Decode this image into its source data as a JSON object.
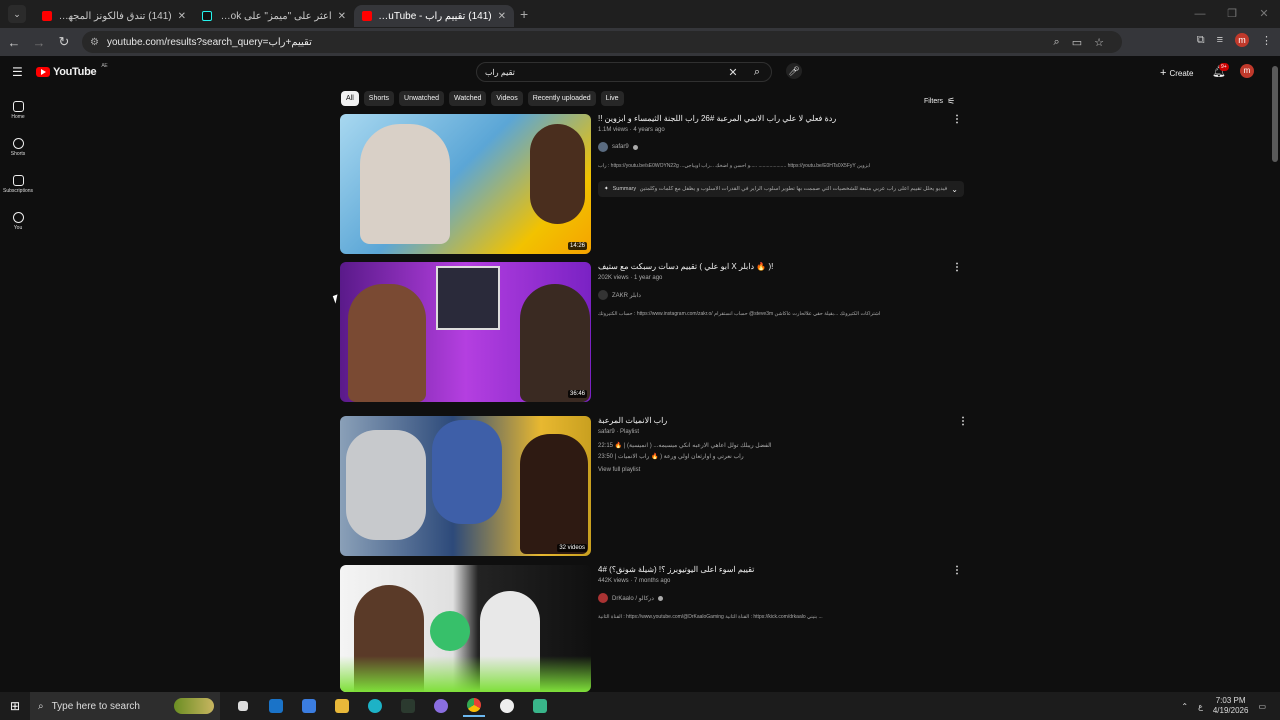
{
  "browser": {
    "tabs": [
      {
        "title": "(141) تندق فالكونز المجهول",
        "favicon": "youtube-icon",
        "active": false
      },
      {
        "title": "اعثر على \"ميمز\" على TikTok | بحث",
        "favicon": "tiktok-icon",
        "active": false
      },
      {
        "title": "(141) تقييم راب - YouTube",
        "favicon": "youtube-icon",
        "active": true
      }
    ],
    "new_tab": "+",
    "url": "youtube.com/results?search_query=تقييم+راب"
  },
  "youtube": {
    "logo_text": "YouTube",
    "logo_region": "AE",
    "search_query": "تقيم راب",
    "create_label": "Create",
    "notif_badge": "9+",
    "avatar_letter": "m",
    "sidebar": [
      {
        "label": "Home",
        "icon": "home-icon"
      },
      {
        "label": "Shorts",
        "icon": "shorts-icon"
      },
      {
        "label": "Subscriptions",
        "icon": "subscriptions-icon"
      },
      {
        "label": "You",
        "icon": "you-icon"
      }
    ],
    "chips": [
      "All",
      "Shorts",
      "Unwatched",
      "Watched",
      "Videos",
      "Recently uploaded",
      "Live"
    ],
    "filters_label": "Filters",
    "results": [
      {
        "title": "ردة فعلي لا علي راب الانمي المرعبة #26 راب اللجنة الثيمساء و ابزوين !!",
        "views": "1.1M views",
        "age": "4 years ago",
        "channel": "safar9",
        "description": "راب : https://youtu.be/sE0WOYN22g ...و احسن و اضخك ...راب اويباجي..... .................... https://youtu.be/E0HTs0X5FyY ابزوين",
        "duration": "14:26",
        "summary_label": "Summary",
        "summary_text": "فيديو يحلل تقييم أعلى راب عربي متبعة للشخصيات التي صممت بها تطوير أسلوب الراير في القدرات الأسلوب و يظفل مع كلمات وكلمتين تنتشي أمثلة متنسية"
      },
      {
        "title": "!( 🔥 دابلر X ابو علي ) تقييم دسات رسبكت مع ستيف",
        "views": "202K views",
        "age": "1 year ago",
        "channel": "ZAKR دابلر",
        "description": "حساب الكتيروتك : https://www.instagram.com/zakr.o/ حساب انستقرام @steve3m اشتراكات الكتيروتك ...بقيلة حقي علالحارت عاكاشن",
        "duration": "36:46"
      },
      {
        "title": "راب الانميات المرعبة",
        "playlist_meta": "safar9 · Playlist",
        "items": [
          "الفضل ريبلك تولل اعاهي الارعبه انكي ميسيمه... ( انميسية) | 🔥 22:15",
          "راب نعرتي و اوارثعان اولي ورعة ( 🔥 راب الانميات | 23:50"
        ],
        "view_full": "View full playlist",
        "duration": "32 videos"
      },
      {
        "title": "تقييم اسوء اعلى اليوتيوبرز ؟! (شيلة شونق؟) #4",
        "views": "442K views",
        "age": "7 months ago",
        "channel": "DrKaalo / دركالو",
        "description": "القناة الثانية : https://www.youtube.com/@DrKaaloGaming القناة الثانية : https://kick.com/drkaalo بنيني ..."
      }
    ]
  },
  "taskbar": {
    "search_placeholder": "Type here to search",
    "time": "7:03 PM",
    "date": "4/19/2026",
    "lang": "ع"
  },
  "colors": {
    "youtube_red": "#ff0000",
    "background": "#0f0f0f",
    "chip_bg": "#272727"
  }
}
